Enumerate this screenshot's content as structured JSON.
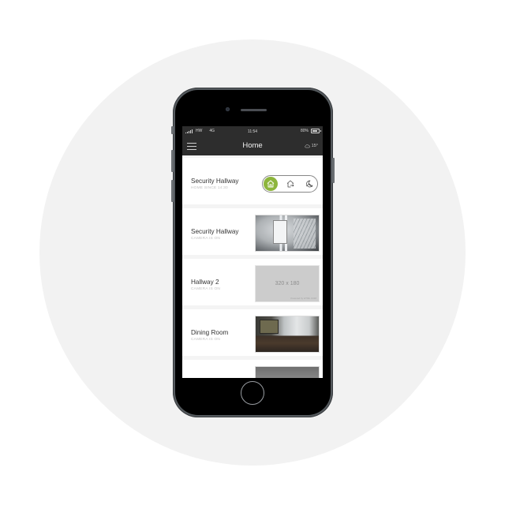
{
  "statusbar": {
    "carrier": "HW",
    "network": "4G",
    "time": "11:54",
    "battery": "80%"
  },
  "navbar": {
    "title": "Home",
    "menu_icon": "hamburger-menu-icon",
    "weather_icon": "cloud-icon",
    "temperature": "15°"
  },
  "cards": [
    {
      "title": "Security Hallway",
      "subtitle": "HOME SINCE 14:30",
      "type": "mode",
      "modes": [
        {
          "name": "home",
          "icon": "home-icon",
          "active": true
        },
        {
          "name": "away",
          "icon": "away-icon",
          "active": false
        },
        {
          "name": "night",
          "icon": "night-icon",
          "active": false
        }
      ],
      "accent": "#8db53c"
    },
    {
      "title": "Security Hallway",
      "subtitle": "CAMERA IS ON",
      "type": "camera",
      "thumbnail": "hallway"
    },
    {
      "title": "Hallway 2",
      "subtitle": "CAMERA IS ON",
      "type": "camera",
      "thumbnail": "placeholder",
      "placeholder_text": "320 x 180",
      "placeholder_caption": "Powered by HTML.COM"
    },
    {
      "title": "Dining Room",
      "subtitle": "CAMERA IS ON",
      "type": "camera",
      "thumbnail": "dining"
    },
    {
      "title": "",
      "subtitle": "",
      "type": "camera",
      "thumbnail": "partial"
    }
  ]
}
